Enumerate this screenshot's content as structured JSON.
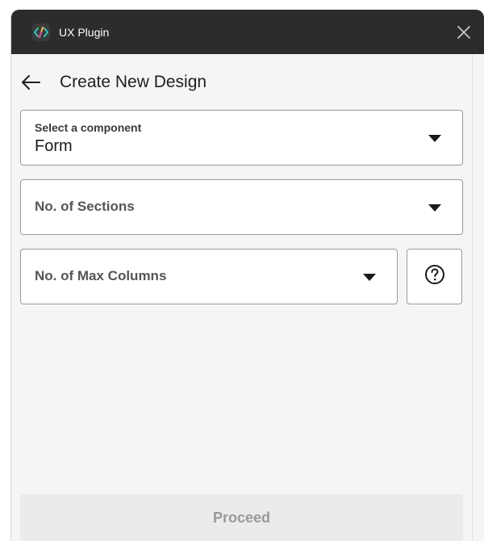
{
  "window": {
    "title": "UX Plugin",
    "logo_icon": "code-brackets-icon",
    "close_icon": "close-icon"
  },
  "header": {
    "back_icon": "arrow-left-icon",
    "title": "Create New Design"
  },
  "form": {
    "component": {
      "label": "Select a component",
      "value": "Form"
    },
    "sections": {
      "placeholder": "No. of Sections"
    },
    "max_columns": {
      "placeholder": "No. of Max Columns"
    },
    "help_icon": "question-circle-icon"
  },
  "footer": {
    "proceed_label": "Proceed",
    "proceed_enabled": false
  },
  "colors": {
    "titlebar": "#2c2c2c",
    "panel": "#f5f5f5",
    "field_border": "#9a9a9a",
    "disabled_button": "#ebebeb",
    "disabled_text": "#9a9a9a",
    "logo_accent_teal": "#2ec4c4",
    "logo_accent_pink": "#e24aa0",
    "logo_accent_yellow": "#f2c230"
  }
}
